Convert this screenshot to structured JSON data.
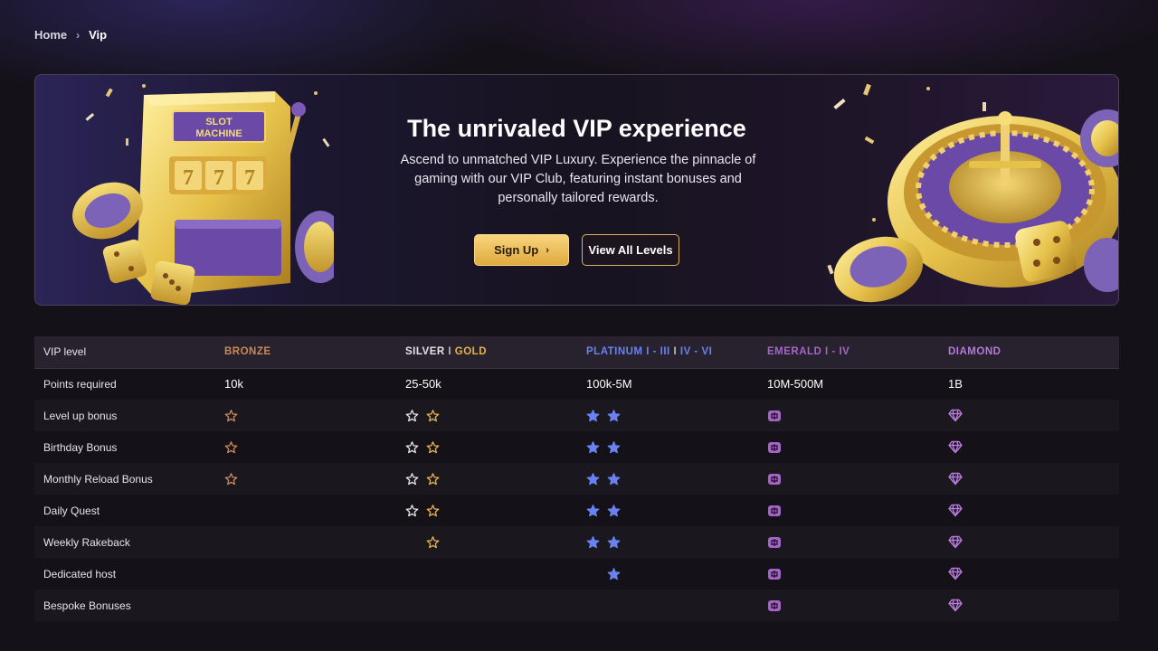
{
  "breadcrumb": {
    "home": "Home",
    "separator": "›",
    "current": "Vip"
  },
  "hero": {
    "title": "The unrivaled VIP experience",
    "description": "Ascend to unmatched VIP Luxury. Experience the pinnacle of gaming with our VIP Club, featuring instant bonuses and personally tailored rewards.",
    "signup_label": "Sign Up",
    "view_levels_label": "View All Levels",
    "slot_machine_sign": "SLOT MACHINE",
    "slot_reels": "777"
  },
  "table": {
    "header": {
      "label": "VIP level",
      "bronze": "BRONZE",
      "silver": "SILVER",
      "silver_sep": "I",
      "gold": "GOLD",
      "platinum_a": "PLATINUM I - III",
      "platinum_sep": "I",
      "platinum_b": "IV - VI",
      "emerald": "EMERALD I - IV",
      "diamond": "DIAMOND"
    },
    "points_row": {
      "label": "Points required",
      "bronze": "10k",
      "silver_gold": "25-50k",
      "platinum": "100k-5M",
      "emerald": "10M-500M",
      "diamond": "1B"
    },
    "feature_rows": [
      {
        "label": "Level up bonus",
        "bronze": true,
        "silver": true,
        "gold": true,
        "platinum": 2,
        "emerald": true,
        "diamond": true
      },
      {
        "label": "Birthday Bonus",
        "bronze": true,
        "silver": true,
        "gold": true,
        "platinum": 2,
        "emerald": true,
        "diamond": true
      },
      {
        "label": "Monthly Reload Bonus",
        "bronze": true,
        "silver": true,
        "gold": true,
        "platinum": 2,
        "emerald": true,
        "diamond": true
      },
      {
        "label": "Daily Quest",
        "bronze": false,
        "silver": true,
        "gold": true,
        "platinum": 2,
        "emerald": true,
        "diamond": true
      },
      {
        "label": "Weekly Rakeback",
        "bronze": false,
        "silver": false,
        "gold": true,
        "platinum": 2,
        "emerald": true,
        "diamond": true
      },
      {
        "label": "Dedicated host",
        "bronze": false,
        "silver": false,
        "gold": false,
        "platinum": 1,
        "emerald": true,
        "diamond": true
      },
      {
        "label": "Bespoke Bonuses",
        "bronze": false,
        "silver": false,
        "gold": false,
        "platinum": 0,
        "emerald": true,
        "diamond": true
      }
    ],
    "icons": {
      "bronze": "bronze-star-outline-icon",
      "silver": "silver-star-outline-icon",
      "gold": "gold-star-outline-icon",
      "platinum": "platinum-star-filled-icon",
      "emerald": "emerald-gem-icon",
      "diamond": "diamond-icon"
    }
  },
  "colors": {
    "background": "#141118",
    "bronze": "#c88a5a",
    "silver": "#e4e4e4",
    "gold": "#e8b24a",
    "platinum": "#6a82f0",
    "emerald": "#a565c8",
    "diamond": "#b57ad8",
    "cta_gold": "#f0c460"
  }
}
